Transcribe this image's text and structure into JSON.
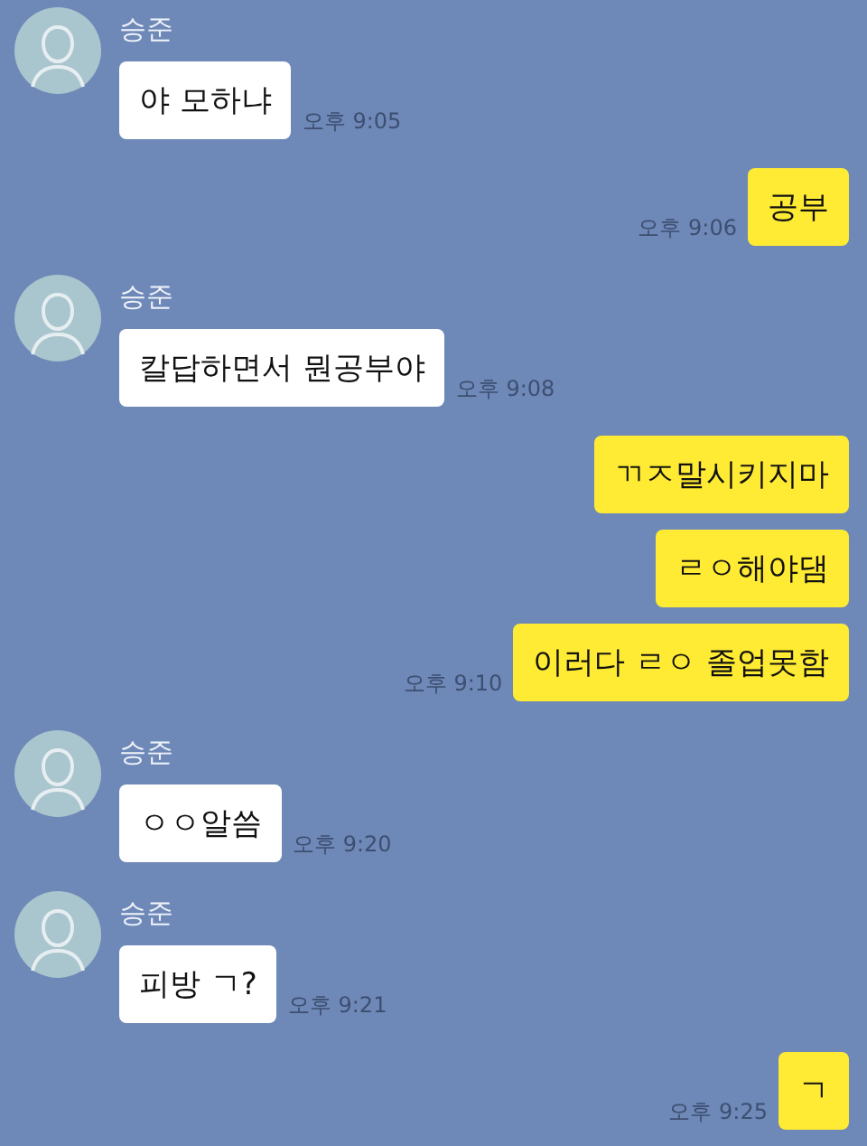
{
  "messages": [
    {
      "kind": "received",
      "sender": "승준",
      "text": "야 모하냐",
      "time": "오후 9:05"
    },
    {
      "kind": "sent",
      "text": "공부",
      "time": "오후 9:06"
    },
    {
      "kind": "received",
      "sender": "승준",
      "text": "칼답하면서 뭔공부야",
      "time": "오후 9:08"
    },
    {
      "kind": "sent",
      "text": "ㄲㅈ말시키지마"
    },
    {
      "kind": "sent",
      "text": "ㄹㅇ해야댐"
    },
    {
      "kind": "sent",
      "text": "이러다 ㄹㅇ 졸업못함",
      "time": "오후 9:10"
    },
    {
      "kind": "received",
      "sender": "승준",
      "text": "ㅇㅇ알씀",
      "time": "오후 9:20"
    },
    {
      "kind": "received",
      "sender": "승준",
      "text": "피방 ㄱ?",
      "time": "오후 9:21"
    },
    {
      "kind": "sent",
      "text": "ㄱ",
      "time": "오후 9:25"
    }
  ]
}
